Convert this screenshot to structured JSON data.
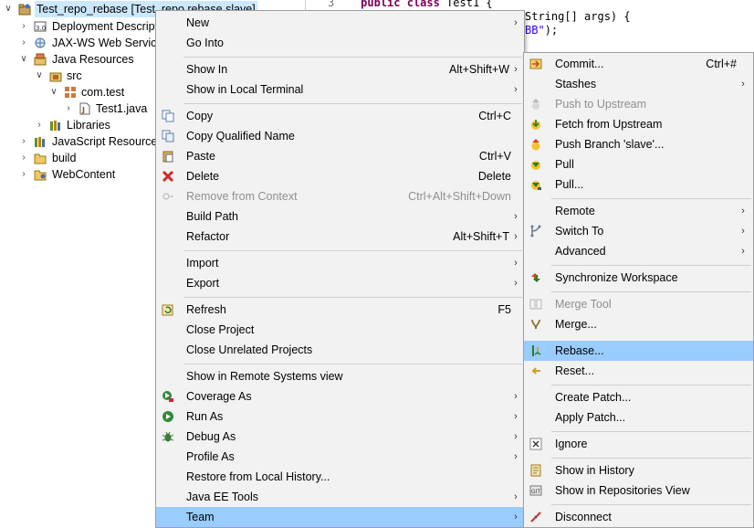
{
  "tree": {
    "root_label": "Test_repo_rebase [Test_repo rebase slave]",
    "items": [
      {
        "label": "Deployment Descript",
        "icon": "deployment-icon",
        "expander": "collapsed"
      },
      {
        "label": "JAX-WS Web Service",
        "icon": "webservice-icon",
        "expander": "collapsed"
      },
      {
        "label": "Java Resources",
        "icon": "java-resources-icon",
        "expander": "expanded"
      },
      {
        "label": "src",
        "icon": "source-folder-icon",
        "expander": "expanded"
      },
      {
        "label": "com.test",
        "icon": "package-icon",
        "expander": "expanded"
      },
      {
        "label": "Test1.java",
        "icon": "java-file-icon",
        "expander": "collapsed"
      },
      {
        "label": "Libraries",
        "icon": "libraries-icon",
        "expander": "collapsed"
      },
      {
        "label": "JavaScript Resources",
        "icon": "js-resources-icon",
        "expander": "collapsed"
      },
      {
        "label": "build",
        "icon": "folder-icon",
        "expander": "collapsed"
      },
      {
        "label": "WebContent",
        "icon": "folder-icon",
        "expander": "collapsed"
      }
    ]
  },
  "editor": {
    "line_number": "3",
    "line3_kw1": "public",
    "line3_kw2": "class",
    "line3_rest": " Test1 {",
    "line4_text": "String[] args) {",
    "line5_str": "BB\"",
    "line5_rest": ");"
  },
  "context_menu": {
    "items": [
      {
        "label": "New",
        "submenu": true
      },
      {
        "label": "Go Into"
      },
      {
        "label": "Show In",
        "shortcut": "Alt+Shift+W",
        "submenu": true
      },
      {
        "label": "Show in Local Terminal",
        "submenu": true
      },
      {
        "label": "Copy",
        "shortcut": "Ctrl+C",
        "icon": "copy-icon"
      },
      {
        "label": "Copy Qualified Name",
        "icon": "copy-qualified-icon"
      },
      {
        "label": "Paste",
        "shortcut": "Ctrl+V",
        "icon": "paste-icon"
      },
      {
        "label": "Delete",
        "shortcut": "Delete",
        "icon": "delete-icon"
      },
      {
        "label": "Remove from Context",
        "shortcut": "Ctrl+Alt+Shift+Down",
        "icon": "remove-context-icon",
        "disabled": true
      },
      {
        "label": "Build Path",
        "submenu": true
      },
      {
        "label": "Refactor",
        "shortcut": "Alt+Shift+T",
        "submenu": true
      },
      {
        "label": "Import",
        "submenu": true
      },
      {
        "label": "Export",
        "submenu": true
      },
      {
        "label": "Refresh",
        "shortcut": "F5",
        "icon": "refresh-icon"
      },
      {
        "label": "Close Project"
      },
      {
        "label": "Close Unrelated Projects"
      },
      {
        "label": "Show in Remote Systems view"
      },
      {
        "label": "Coverage As",
        "submenu": true,
        "icon": "coverage-icon"
      },
      {
        "label": "Run As",
        "submenu": true,
        "icon": "run-icon"
      },
      {
        "label": "Debug As",
        "submenu": true,
        "icon": "debug-icon"
      },
      {
        "label": "Profile As",
        "submenu": true
      },
      {
        "label": "Restore from Local History..."
      },
      {
        "label": "Java EE Tools",
        "submenu": true
      },
      {
        "label": "Team",
        "submenu": true,
        "highlighted": true
      }
    ]
  },
  "team_menu": {
    "items": [
      {
        "label": "Commit...",
        "shortcut": "Ctrl+#",
        "icon": "commit-icon"
      },
      {
        "label": "Stashes",
        "submenu": true
      },
      {
        "label": "Push to Upstream",
        "icon": "push-upstream-icon",
        "disabled": true
      },
      {
        "label": "Fetch from Upstream",
        "icon": "fetch-icon"
      },
      {
        "label": "Push Branch 'slave'...",
        "icon": "push-branch-icon"
      },
      {
        "label": "Pull",
        "icon": "pull-icon"
      },
      {
        "label": "Pull...",
        "icon": "pull-dialog-icon"
      },
      {
        "label": "Remote",
        "submenu": true
      },
      {
        "label": "Switch To",
        "submenu": true,
        "icon": "switch-branch-icon"
      },
      {
        "label": "Advanced",
        "submenu": true
      },
      {
        "label": "Synchronize Workspace",
        "icon": "synchronize-icon"
      },
      {
        "label": "Merge Tool",
        "icon": "merge-tool-icon",
        "disabled": true
      },
      {
        "label": "Merge...",
        "icon": "merge-icon"
      },
      {
        "label": "Rebase...",
        "icon": "rebase-icon",
        "highlighted": true
      },
      {
        "label": "Reset...",
        "icon": "reset-icon"
      },
      {
        "label": "Create Patch..."
      },
      {
        "label": "Apply Patch..."
      },
      {
        "label": "Ignore",
        "icon": "ignore-icon"
      },
      {
        "label": "Show in History",
        "icon": "history-icon"
      },
      {
        "label": "Show in Repositories View",
        "icon": "repositories-icon"
      },
      {
        "label": "Disconnect",
        "icon": "disconnect-icon"
      }
    ]
  },
  "colors": {
    "menu_bg": "#f2f2f2",
    "highlight": "#99ccff",
    "disabled_text": "#8f8f8f",
    "tree_selection": "#cce8ff",
    "java_keyword": "#7f0055",
    "java_string": "#2a00ff"
  }
}
